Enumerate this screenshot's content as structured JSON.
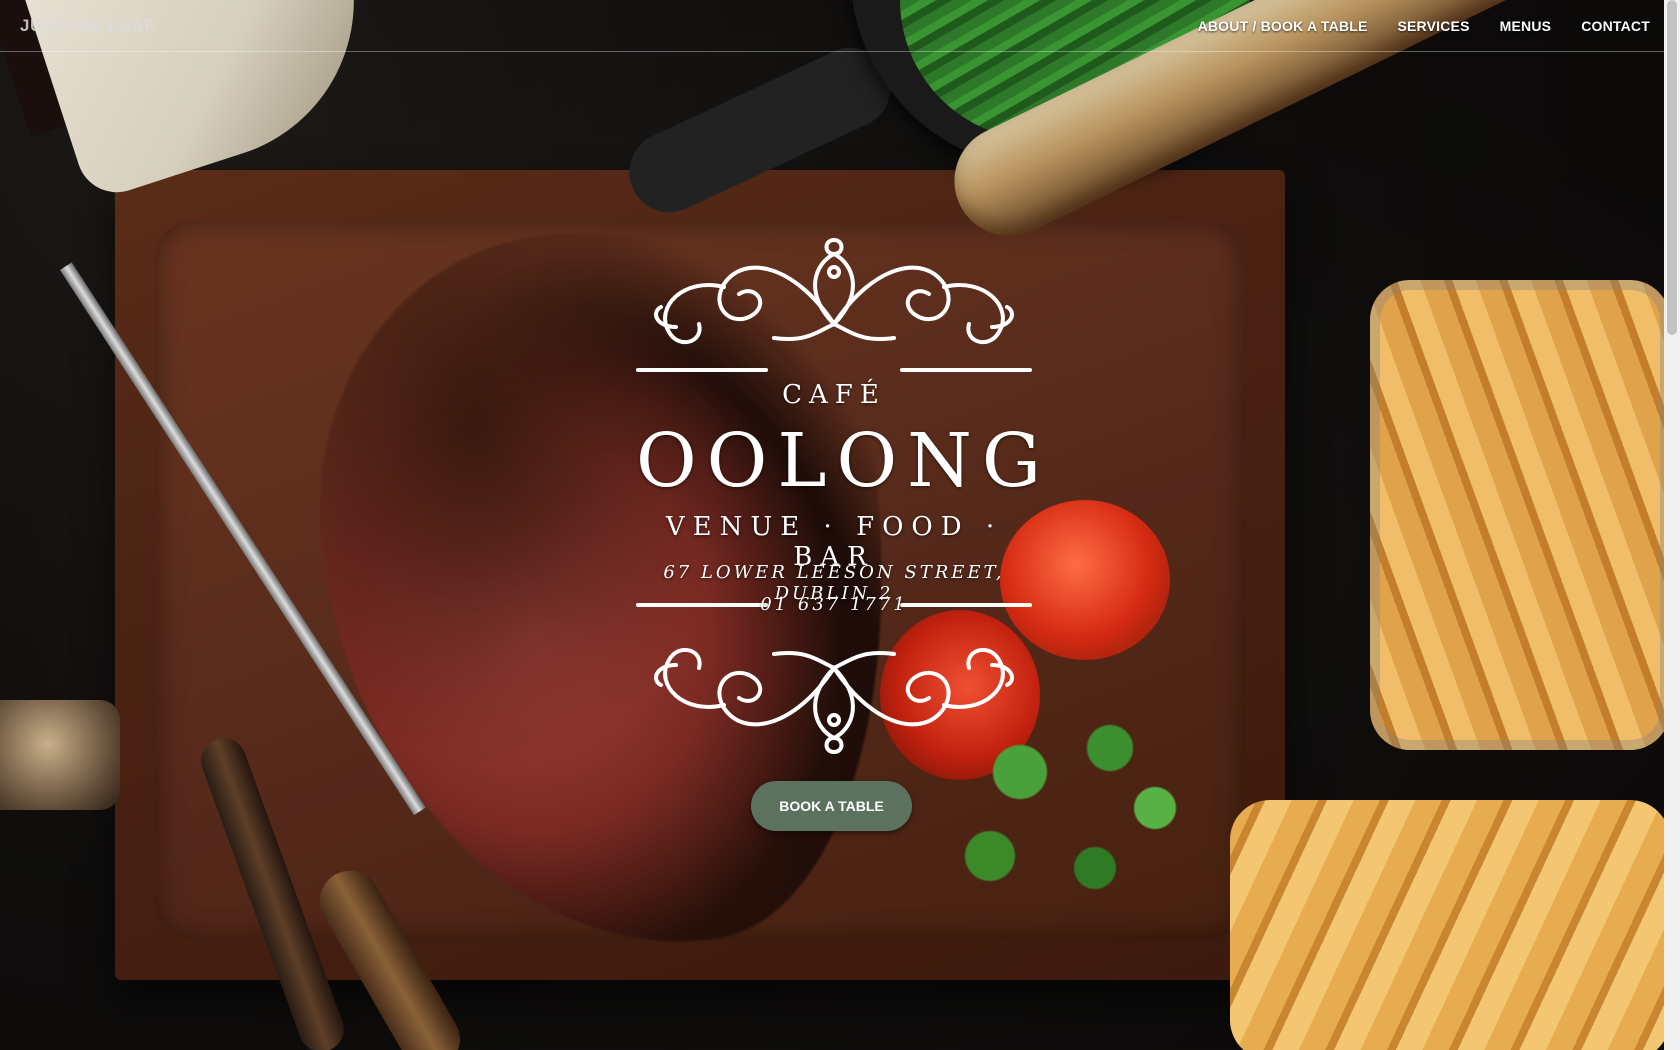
{
  "nav": {
    "brand": "JUSTONE LEAF",
    "links": [
      "ABOUT / BOOK A TABLE",
      "SERVICES",
      "MENUS",
      "CONTACT"
    ]
  },
  "hero": {
    "cafe": "CAFÉ",
    "name": "OOLONG",
    "tagline": "VENUE · FOOD · BAR",
    "address": "67 LOWER LEESON STREET, DUBLIN 2",
    "phone": "01 637 1771",
    "cta_label": "BOOK A TABLE"
  },
  "colors": {
    "cta_background": "#5c725f",
    "text": "#ffffff"
  }
}
